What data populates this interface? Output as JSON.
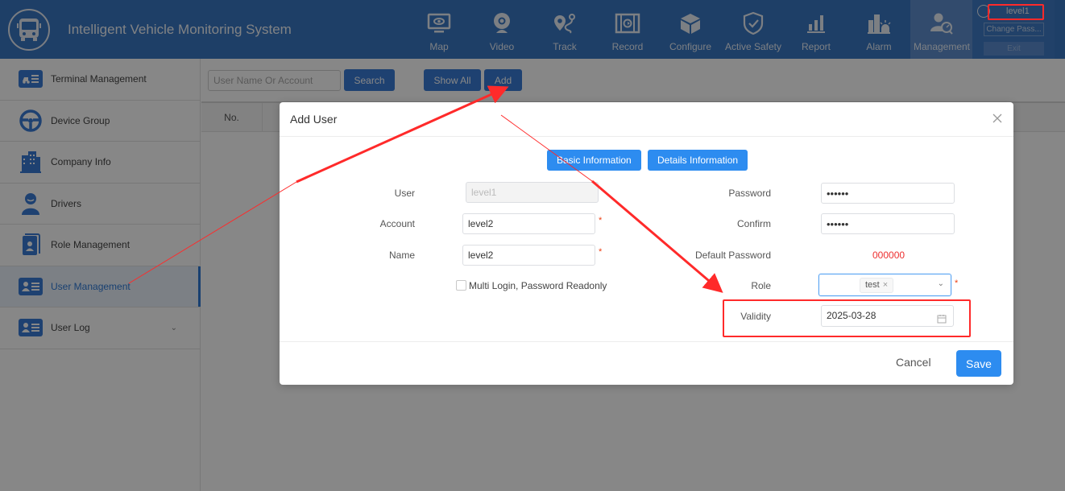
{
  "header": {
    "app_title": "Intelligent Vehicle Monitoring System",
    "logo_icon": "bus-icon",
    "nav": [
      {
        "label": "Map",
        "icon": "monitor-eye-icon",
        "active": false
      },
      {
        "label": "Video",
        "icon": "webcam-icon",
        "active": false
      },
      {
        "label": "Track",
        "icon": "route-pin-icon",
        "active": false
      },
      {
        "label": "Record",
        "icon": "film-replay-icon",
        "active": false
      },
      {
        "label": "Configure",
        "icon": "cube-icon",
        "active": false
      },
      {
        "label": "Active Safety",
        "icon": "shield-check-icon",
        "active": false
      },
      {
        "label": "Report",
        "icon": "bar-chart-icon",
        "active": false
      },
      {
        "label": "Alarm",
        "icon": "alarm-building-icon",
        "active": false
      },
      {
        "label": "Management",
        "icon": "user-manage-icon",
        "active": true
      }
    ],
    "user": {
      "name": "level1",
      "change_password": "Change Pass...",
      "exit": "Exit"
    }
  },
  "sidebar": {
    "items": [
      {
        "label": "Terminal Management",
        "icon": "truck-list-icon",
        "active": false
      },
      {
        "label": "Device Group",
        "icon": "steering-wheel-icon",
        "active": false
      },
      {
        "label": "Company Info",
        "icon": "building-icon",
        "active": false
      },
      {
        "label": "Drivers",
        "icon": "driver-icon",
        "active": false
      },
      {
        "label": "Role Management",
        "icon": "role-book-icon",
        "active": false
      },
      {
        "label": "User Management",
        "icon": "user-card-icon",
        "active": true
      },
      {
        "label": "User Log",
        "icon": "user-card-icon",
        "active": false,
        "expandable": true
      }
    ]
  },
  "toolbar": {
    "search_placeholder": "User Name Or Account",
    "search_label": "Search",
    "show_all_label": "Show All",
    "add_label": "Add"
  },
  "table": {
    "columns": [
      "No."
    ]
  },
  "modal": {
    "title": "Add User",
    "tabs": [
      "Basic Information",
      "Details Information"
    ],
    "fields": {
      "user_label": "User",
      "user_value": "level1",
      "account_label": "Account",
      "account_value": "level2",
      "name_label": "Name",
      "name_value": "level2",
      "multi_login_label": "Multi Login, Password Readonly",
      "multi_login_checked": false,
      "password_label": "Password",
      "password_value": "••••••",
      "confirm_label": "Confirm",
      "confirm_value": "••••••",
      "default_password_label": "Default Password",
      "default_password_value": "000000",
      "role_label": "Role",
      "role_tags": [
        "test"
      ],
      "validity_label": "Validity",
      "validity_value": "2025-03-28",
      "required_mark": "*"
    },
    "cancel_label": "Cancel",
    "save_label": "Save"
  },
  "colors": {
    "header_bg": "#3a77c2",
    "primary": "#2d8cf0",
    "annotation_red": "#ff2a2a",
    "default_password_red": "#ed2f2f"
  }
}
